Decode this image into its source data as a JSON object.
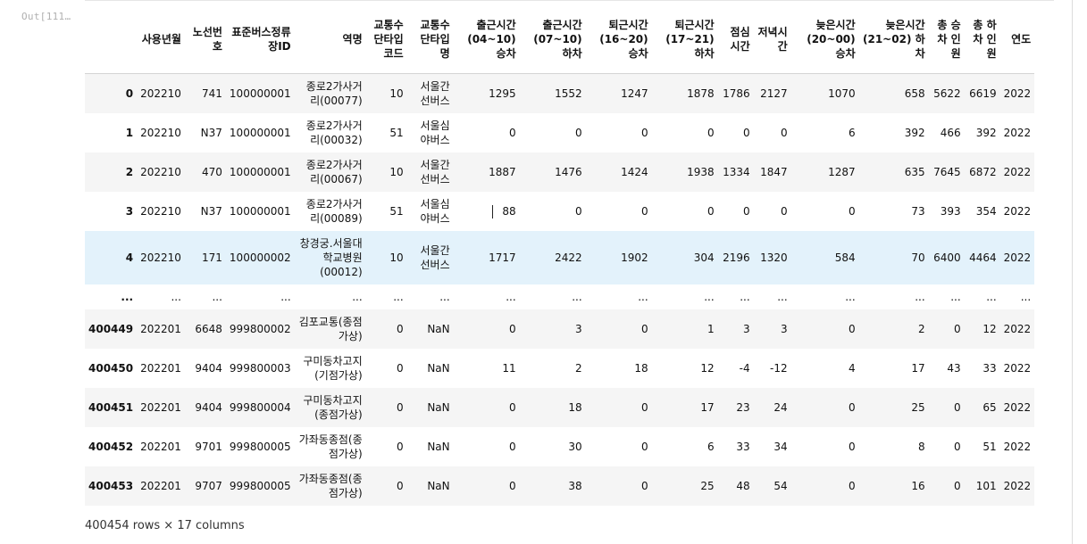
{
  "output_prompt": "Out[111…",
  "table": {
    "columns": [
      "",
      "사용년월",
      "노선번호",
      "표준버스정류장ID",
      "역명",
      "교통수단타입코드",
      "교통수단타입명",
      "출근시간(04~10) 승차",
      "출근시간(07~10) 하차",
      "퇴근시간(16~20) 승차",
      "퇴근시간(17~21) 하차",
      "점심시간",
      "저녁시간",
      "늦은시간(20~00) 승차",
      "늦은시간(21~02) 하차",
      "총 승차 인원",
      "총 하차 인원",
      "연도"
    ],
    "rows": [
      [
        "0",
        "202210",
        "741",
        "100000001",
        "종로2가사거리(00077)",
        "10",
        "서울간선버스",
        "1295",
        "1552",
        "1247",
        "1878",
        "1786",
        "2127",
        "1070",
        "658",
        "5622",
        "6619",
        "2022"
      ],
      [
        "1",
        "202210",
        "N37",
        "100000001",
        "종로2가사거리(00032)",
        "51",
        "서울심야버스",
        "0",
        "0",
        "0",
        "0",
        "0",
        "0",
        "6",
        "392",
        "466",
        "392",
        "2022"
      ],
      [
        "2",
        "202210",
        "470",
        "100000001",
        "종로2가사거리(00067)",
        "10",
        "서울간선버스",
        "1887",
        "1476",
        "1424",
        "1938",
        "1334",
        "1847",
        "1287",
        "635",
        "7645",
        "6872",
        "2022"
      ],
      [
        "3",
        "202210",
        "N37",
        "100000001",
        "종로2가사거리(00089)",
        "51",
        "서울심야버스",
        "88",
        "0",
        "0",
        "0",
        "0",
        "0",
        "0",
        "73",
        "393",
        "354",
        "2022"
      ],
      [
        "4",
        "202210",
        "171",
        "100000002",
        "창경궁.서울대학교병원(00012)",
        "10",
        "서울간선버스",
        "1717",
        "2422",
        "1902",
        "304",
        "2196",
        "1320",
        "584",
        "70",
        "6400",
        "4464",
        "2022"
      ],
      [
        "...",
        "...",
        "...",
        "...",
        "...",
        "...",
        "...",
        "...",
        "...",
        "...",
        "...",
        "...",
        "...",
        "...",
        "...",
        "...",
        "...",
        "..."
      ],
      [
        "400449",
        "202201",
        "6648",
        "999800002",
        "김포교통(종점가상)",
        "0",
        "NaN",
        "0",
        "3",
        "0",
        "1",
        "3",
        "3",
        "0",
        "2",
        "0",
        "12",
        "2022"
      ],
      [
        "400450",
        "202201",
        "9404",
        "999800003",
        "구미동차고지(기점가상)",
        "0",
        "NaN",
        "11",
        "2",
        "18",
        "12",
        "-4",
        "-12",
        "4",
        "17",
        "43",
        "33",
        "2022"
      ],
      [
        "400451",
        "202201",
        "9404",
        "999800004",
        "구미동차고지(종점가상)",
        "0",
        "NaN",
        "0",
        "18",
        "0",
        "17",
        "23",
        "24",
        "0",
        "25",
        "0",
        "65",
        "2022"
      ],
      [
        "400452",
        "202201",
        "9701",
        "999800005",
        "가좌동종점(종점가상)",
        "0",
        "NaN",
        "0",
        "30",
        "0",
        "6",
        "33",
        "34",
        "0",
        "8",
        "0",
        "51",
        "2022"
      ],
      [
        "400453",
        "202201",
        "9707",
        "999800005",
        "가좌동종점(종점가상)",
        "0",
        "NaN",
        "0",
        "38",
        "0",
        "25",
        "48",
        "54",
        "0",
        "16",
        "0",
        "101",
        "2022"
      ]
    ]
  },
  "footer": "400454 rows × 17 columns"
}
